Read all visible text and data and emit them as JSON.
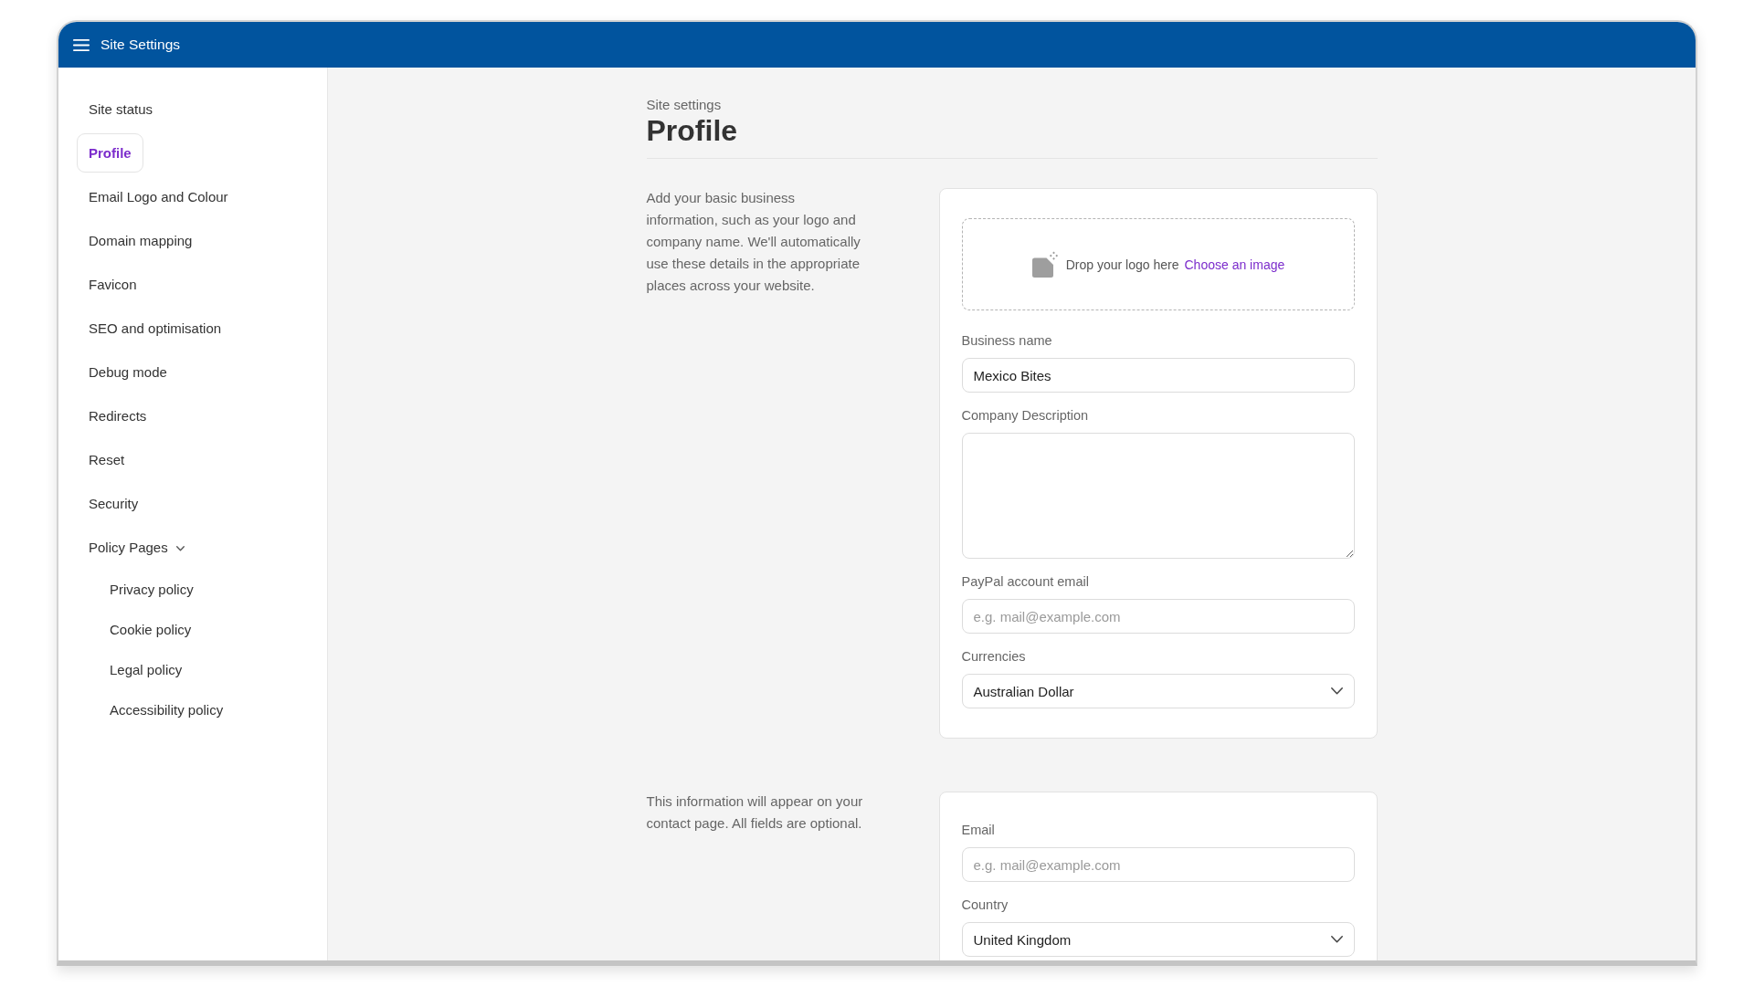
{
  "window": {
    "title": "Site Settings"
  },
  "sidebar": {
    "items": [
      {
        "label": "Site status",
        "selected": false
      },
      {
        "label": "Profile",
        "selected": true
      },
      {
        "label": "Email Logo and Colour",
        "selected": false
      },
      {
        "label": "Domain mapping",
        "selected": false
      },
      {
        "label": "Favicon",
        "selected": false
      },
      {
        "label": "SEO and optimisation",
        "selected": false
      },
      {
        "label": "Debug mode",
        "selected": false
      },
      {
        "label": "Redirects",
        "selected": false
      },
      {
        "label": "Reset",
        "selected": false
      },
      {
        "label": "Security",
        "selected": false
      },
      {
        "label": "Policy Pages",
        "selected": false,
        "expanded": true,
        "children": [
          {
            "label": "Privacy policy",
            "selected": false
          },
          {
            "label": "Cookie policy",
            "selected": false
          },
          {
            "label": "Legal policy",
            "selected": false
          },
          {
            "label": "Accessibility policy",
            "selected": false
          }
        ]
      }
    ]
  },
  "page": {
    "breadcrumb": "Site settings",
    "title": "Profile"
  },
  "sections": [
    {
      "description": "Add your basic business information, such as your logo and company name. We'll automatically use these details in the appropriate places across your website.",
      "fields": [
        {
          "kind": "upload",
          "hint": "Drop your logo here",
          "link": "Choose an image"
        },
        {
          "kind": "input",
          "label": "Business name",
          "value": "Mexico Bites"
        },
        {
          "kind": "textarea",
          "label": "Company Description"
        },
        {
          "kind": "input",
          "label": "PayPal account email",
          "placeholder": "e.g. mail@example.com"
        },
        {
          "kind": "select",
          "label": "Currencies",
          "value": "Australian Dollar"
        }
      ]
    },
    {
      "description": "This information will appear on your contact page. All fields are optional.",
      "fields": [
        {
          "kind": "input",
          "label": "Email",
          "placeholder": "e.g. mail@example.com"
        },
        {
          "kind": "select",
          "label": "Country",
          "value": "United Kingdom"
        }
      ]
    }
  ]
}
